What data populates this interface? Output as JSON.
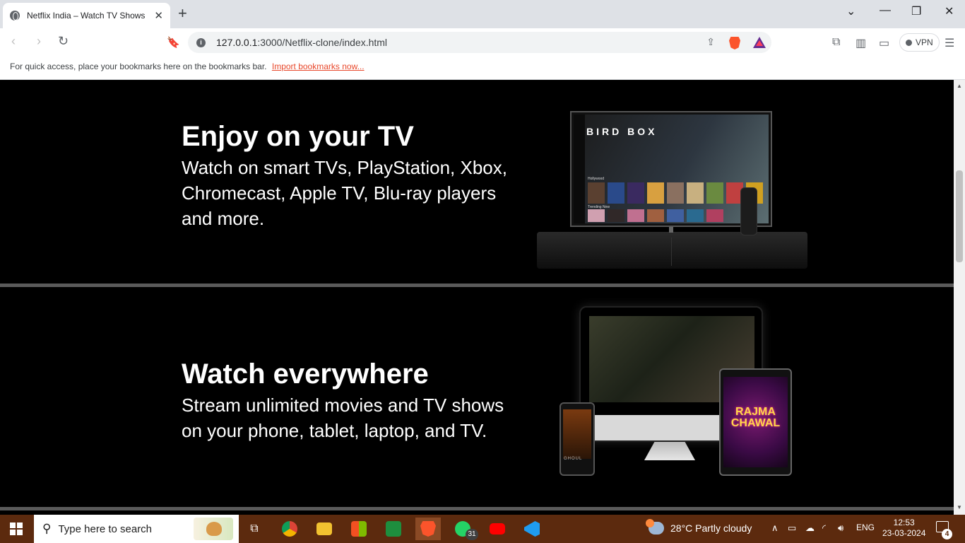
{
  "browser": {
    "tab_title": "Netflix India – Watch TV Shows Online",
    "url_host": "127.0.0.1",
    "url_rest": ":3000/Netflix-clone/index.html",
    "vpn_label": "VPN",
    "bookmarks_hint": "For quick access, place your bookmarks here on the bookmarks bar.",
    "import_link": "Import bookmarks now..."
  },
  "sections": [
    {
      "title": "Enjoy on your TV",
      "description": "Watch on smart TVs, PlayStation, Xbox, Chromecast, Apple TV, Blu-ray players and more.",
      "tv_movie_title": "BIRD BOX",
      "tv_row1": "Hollywood",
      "tv_row2": "Trending Now"
    },
    {
      "title": "Watch everywhere",
      "description": "Stream unlimited movies and TV shows on your phone, tablet, laptop, and TV.",
      "phone_title": "GHOUL",
      "tablet_title": "RAJMA CHAWAL"
    }
  ],
  "taskbar": {
    "search_placeholder": "Type here to search",
    "whatsapp_badge": "31",
    "weather_text": "28°C  Partly cloudy",
    "language": "ENG",
    "time": "12:53",
    "date": "23-03-2024",
    "notification_count": "4",
    "colors": {
      "taskbar": "#5c2a0e",
      "brave": "#fb542b",
      "netflix_red": "#e50914"
    }
  }
}
